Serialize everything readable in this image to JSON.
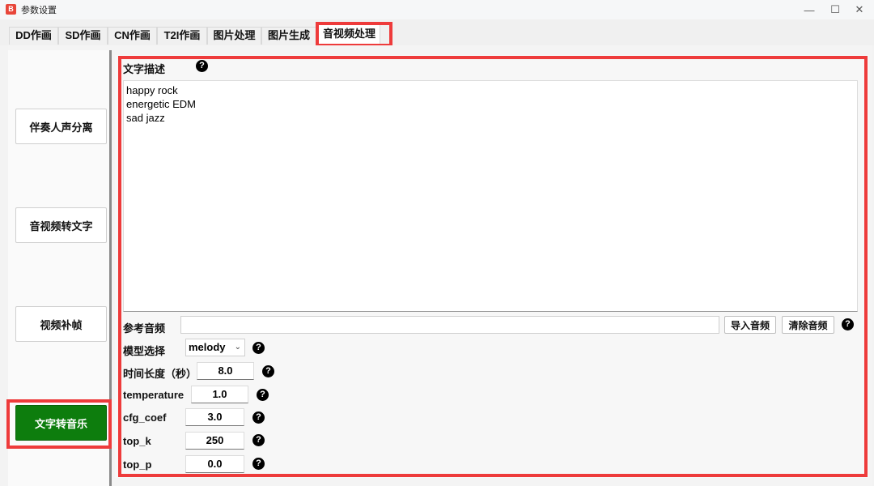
{
  "window": {
    "title": "参数设置",
    "icon_label": "B",
    "minimize": "—",
    "maximize": "☐",
    "close": "✕"
  },
  "tabs": [
    {
      "label": "DD作画"
    },
    {
      "label": "SD作画"
    },
    {
      "label": "CN作画"
    },
    {
      "label": "T2I作画"
    },
    {
      "label": "图片处理"
    },
    {
      "label": "图片生成"
    },
    {
      "label": "音视频处理",
      "active": true
    }
  ],
  "sidebar": {
    "items": [
      {
        "label": "伴奏人声分离"
      },
      {
        "label": "音视频转文字"
      },
      {
        "label": "视频补帧"
      },
      {
        "label": "文字转音乐",
        "selected": true
      }
    ]
  },
  "form": {
    "text_desc_label": "文字描述",
    "text_desc_value": "happy rock\nenergetic EDM\nsad jazz",
    "ref_audio_label": "参考音频",
    "ref_audio_value": "",
    "import_audio_button": "导入音频",
    "clear_audio_button": "清除音频",
    "model_label": "模型选择",
    "model_value": "melody",
    "duration_label": "时间长度（秒）",
    "duration_value": "8.0",
    "temperature_label": "temperature",
    "temperature_value": "1.0",
    "cfg_coef_label": "cfg_coef",
    "cfg_coef_value": "3.0",
    "top_k_label": "top_k",
    "top_k_value": "250",
    "top_p_label": "top_p",
    "top_p_value": "0.0",
    "help_glyph": "?"
  },
  "colors": {
    "highlight": "#ee3b3b",
    "selected_button": "#0d7d0d"
  }
}
